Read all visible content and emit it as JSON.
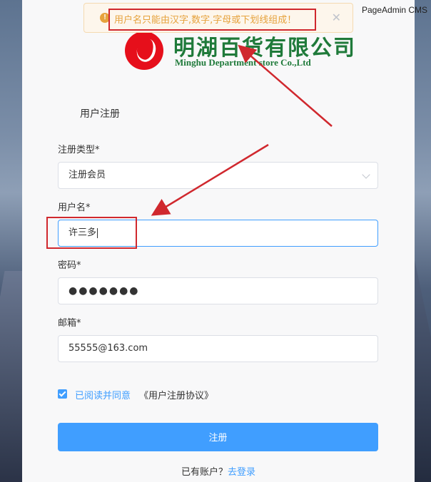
{
  "watermark": "PageAdmin CMS",
  "toast": {
    "icon": "warning-icon",
    "message": "用户名只能由汉字,数字,字母或下划线组成！",
    "close_icon": "close-icon"
  },
  "logo": {
    "cn_name": "明湖百货有限公司",
    "en_name": "Minghu Department store Co.,Ltd"
  },
  "form": {
    "title": "用户注册",
    "type_label": "注册类型*",
    "type_value": "注册会员",
    "username_label": "用户名*",
    "username_value": "许三多",
    "password_label": "密码*",
    "password_value": "●●●●●●●",
    "email_label": "邮箱*",
    "email_value": "55555@163.com",
    "agree_checked": true,
    "agree_text": "已阅读并同意",
    "agreement_link": "《用户注册协议》",
    "submit_label": "注册",
    "has_account_text": "已有账户？",
    "login_link": "去登录"
  },
  "colors": {
    "accent": "#409eff",
    "warning": "#e6a23c",
    "annotation": "#d0282e",
    "logo_green": "#1f7a3a",
    "logo_red": "#e60f1b"
  }
}
